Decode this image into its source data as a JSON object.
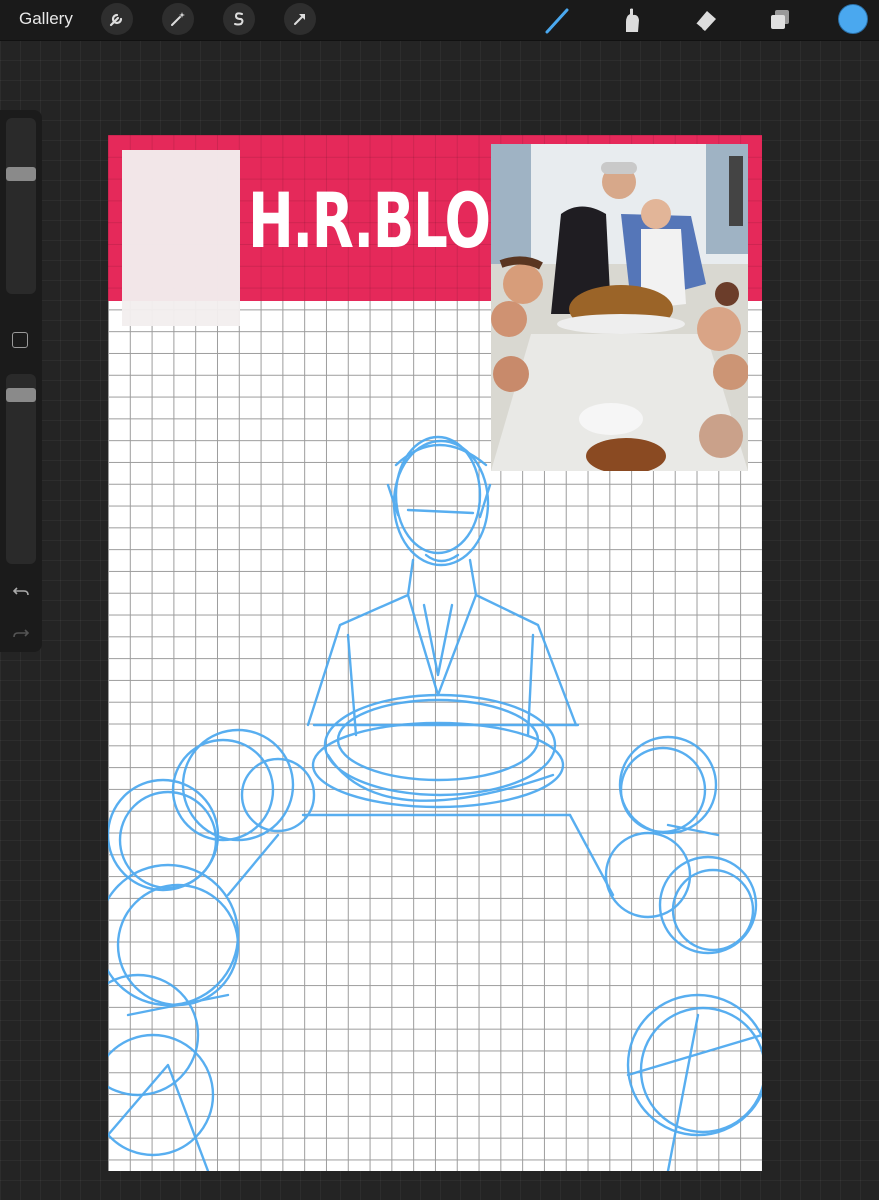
{
  "app": {
    "gallery_label": "Gallery"
  },
  "toolbar": {
    "left_tools": [
      "wrench-icon",
      "magic-wand-icon",
      "selection-s-icon",
      "transform-arrow-icon"
    ],
    "right_tools": [
      "brush-icon",
      "smudge-icon",
      "eraser-icon",
      "layers-icon"
    ],
    "brush_color": "#4aa8ef"
  },
  "sidebar": {
    "brush_size": 0.94,
    "brush_opacity": 0.9
  },
  "canvas": {
    "banner_color": "#e5295a",
    "banner_title": "H.R.BLOOD",
    "sketch_color": "#4aa8ef"
  }
}
